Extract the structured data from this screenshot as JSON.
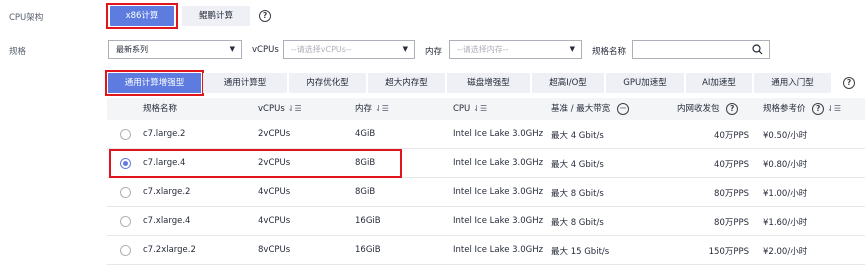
{
  "cpu_arch": {
    "label": "CPU架构",
    "options": [
      "x86计算",
      "鲲鹏计算"
    ],
    "selected": "x86计算"
  },
  "spec": {
    "label": "规格",
    "series_select": "最新系列",
    "vcpus_label": "vCPUs",
    "vcpus_placeholder": "--请选择vCPUs--",
    "memory_label": "内存",
    "memory_placeholder": "--请选择内存--",
    "name_label": "规格名称",
    "name_value": ""
  },
  "tabs": [
    "通用计算增强型",
    "通用计算型",
    "内存优化型",
    "超大内存型",
    "磁盘增强型",
    "超高I/O型",
    "GPU加速型",
    "AI加速型",
    "通用入门型"
  ],
  "active_tab": "通用计算增强型",
  "table": {
    "headers": {
      "name": "规格名称",
      "vcpus": "vCPUs",
      "memory": "内存",
      "cpu": "CPU",
      "bandwidth": "基准 / 最大带宽",
      "pps": "内网收发包",
      "price": "规格参考价"
    },
    "rows": [
      {
        "name": "c7.large.2",
        "vcpus": "2vCPUs",
        "memory": "4GiB",
        "cpu": "Intel Ice Lake 3.0GHz",
        "bandwidth": "最大 4 Gbit/s",
        "pps": "40万PPS",
        "price": "¥0.50/小时",
        "selected": false
      },
      {
        "name": "c7.large.4",
        "vcpus": "2vCPUs",
        "memory": "8GiB",
        "cpu": "Intel Ice Lake 3.0GHz",
        "bandwidth": "最大 4 Gbit/s",
        "pps": "40万PPS",
        "price": "¥0.80/小时",
        "selected": true
      },
      {
        "name": "c7.xlarge.2",
        "vcpus": "4vCPUs",
        "memory": "8GiB",
        "cpu": "Intel Ice Lake 3.0GHz",
        "bandwidth": "最大 8 Gbit/s",
        "pps": "80万PPS",
        "price": "¥1.00/小时",
        "selected": false
      },
      {
        "name": "c7.xlarge.4",
        "vcpus": "4vCPUs",
        "memory": "16GiB",
        "cpu": "Intel Ice Lake 3.0GHz",
        "bandwidth": "最大 8 Gbit/s",
        "pps": "80万PPS",
        "price": "¥1.60/小时",
        "selected": false
      },
      {
        "name": "c7.2xlarge.2",
        "vcpus": "8vCPUs",
        "memory": "16GiB",
        "cpu": "Intel Ice Lake 3.0GHz",
        "bandwidth": "最大 15 Gbit/s",
        "pps": "150万PPS",
        "price": "¥2.00/小时",
        "selected": false
      }
    ]
  },
  "icons": {
    "help": "?",
    "search": "search-icon",
    "sort": "sort-icon",
    "more": "more-icon",
    "caret": "caret-down-icon"
  },
  "colors": {
    "accent": "#5e7ce0",
    "highlight": "#e0161c"
  }
}
